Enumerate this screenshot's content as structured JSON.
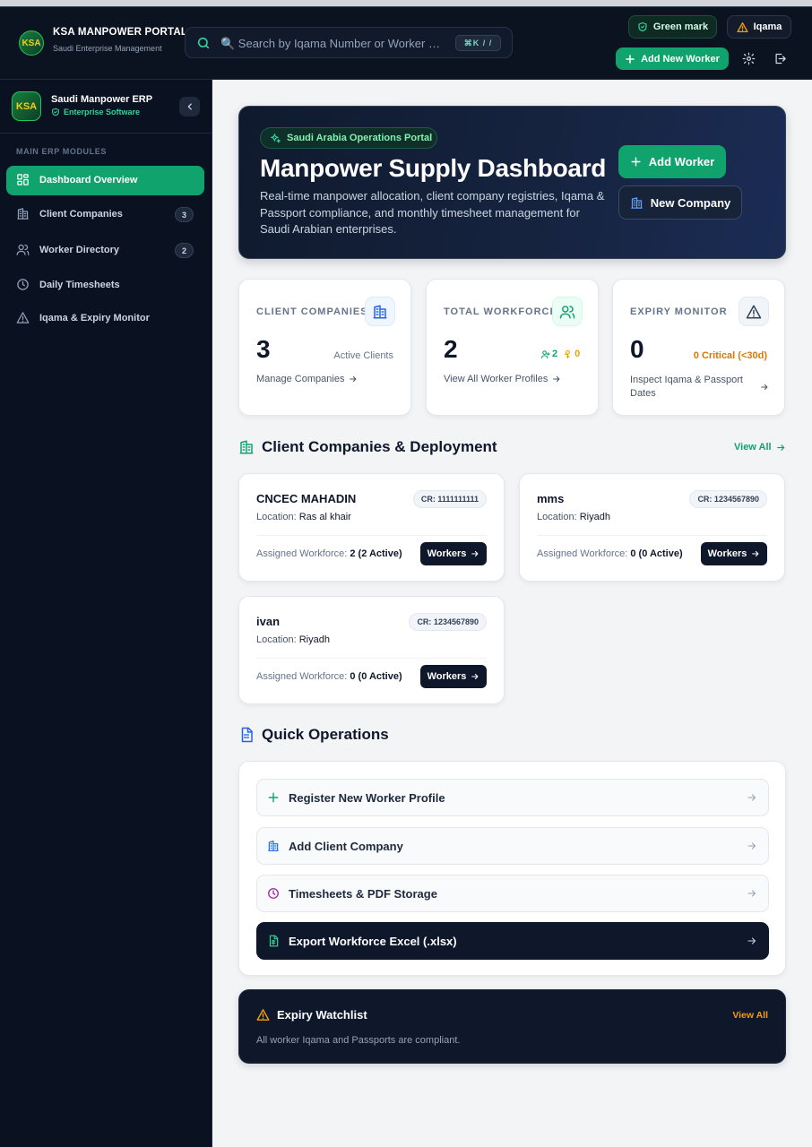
{
  "header": {
    "logo_text": "KSA",
    "title": "KSA MANPOWER PORTAL",
    "subtitle": "Saudi Enterprise Management",
    "search_placeholder": "🔍 Search by Iqama Number or Worker N...",
    "search_shortcut": "⌘K / /",
    "green_mark_label": "Green mark",
    "iqama_label": "Iqama",
    "add_worker_label": "Add New Worker"
  },
  "sidebar": {
    "logo_text": "KSA",
    "title": "Saudi Manpower ERP",
    "subtitle": "Enterprise Software",
    "section_label": "MAIN ERP MODULES",
    "items": [
      {
        "label": "Dashboard Overview",
        "badge": ""
      },
      {
        "label": "Client Companies",
        "badge": "3"
      },
      {
        "label": "Worker Directory",
        "badge": "2"
      },
      {
        "label": "Daily Timesheets",
        "badge": ""
      },
      {
        "label": "Iqama & Expiry Monitor",
        "badge": ""
      }
    ]
  },
  "hero": {
    "chip": "Saudi Arabia Operations Portal",
    "title": "Manpower Supply Dashboard",
    "description": "Real-time manpower allocation, client company registries, Iqama & Passport compliance, and monthly timesheet management for Saudi Arabian enterprises.",
    "add_worker_label": "Add Worker",
    "new_company_label": "New Company"
  },
  "stats": {
    "companies": {
      "label": "CLIENT COMPANIES",
      "value": "3",
      "note": "Active Clients",
      "link": "Manage Companies"
    },
    "workforce": {
      "label": "TOTAL WORKFORCE",
      "value": "2",
      "male_count": "2",
      "female_count": "0",
      "link": "View All Worker Profiles"
    },
    "expiry": {
      "label": "EXPIRY MONITOR",
      "value": "0",
      "note": "0 Critical (<30d)",
      "link": "Inspect Iqama & Passport Dates"
    }
  },
  "companies_section": {
    "title": "Client Companies & Deployment",
    "view_all": "View All",
    "location_label": "Location:",
    "workforce_label": "Assigned Workforce:",
    "workers_button": "Workers",
    "items": [
      {
        "name": "CNCEC MAHADIN",
        "cr": "CR: 1111111111",
        "location": "Ras al khair",
        "workforce": "2 (2 Active)"
      },
      {
        "name": "mms",
        "cr": "CR: 1234567890",
        "location": "Riyadh",
        "workforce": "0 (0 Active)"
      },
      {
        "name": "ivan",
        "cr": "CR: 1234567890",
        "location": "Riyadh",
        "workforce": "0 (0 Active)"
      }
    ]
  },
  "quick_ops": {
    "title": "Quick Operations",
    "items": [
      {
        "label": "Register New Worker Profile"
      },
      {
        "label": "Add Client Company"
      },
      {
        "label": "Timesheets & PDF Storage"
      },
      {
        "label": "Export Workforce Excel (.xlsx)"
      }
    ]
  },
  "watchlist": {
    "title": "Expiry Watchlist",
    "view_all": "View All",
    "message": "All worker Iqama and Passports are compliant."
  },
  "colors": {
    "accent_green": "#10a36e",
    "navy": "#0f172a",
    "warning_amber": "#f59e0b"
  }
}
